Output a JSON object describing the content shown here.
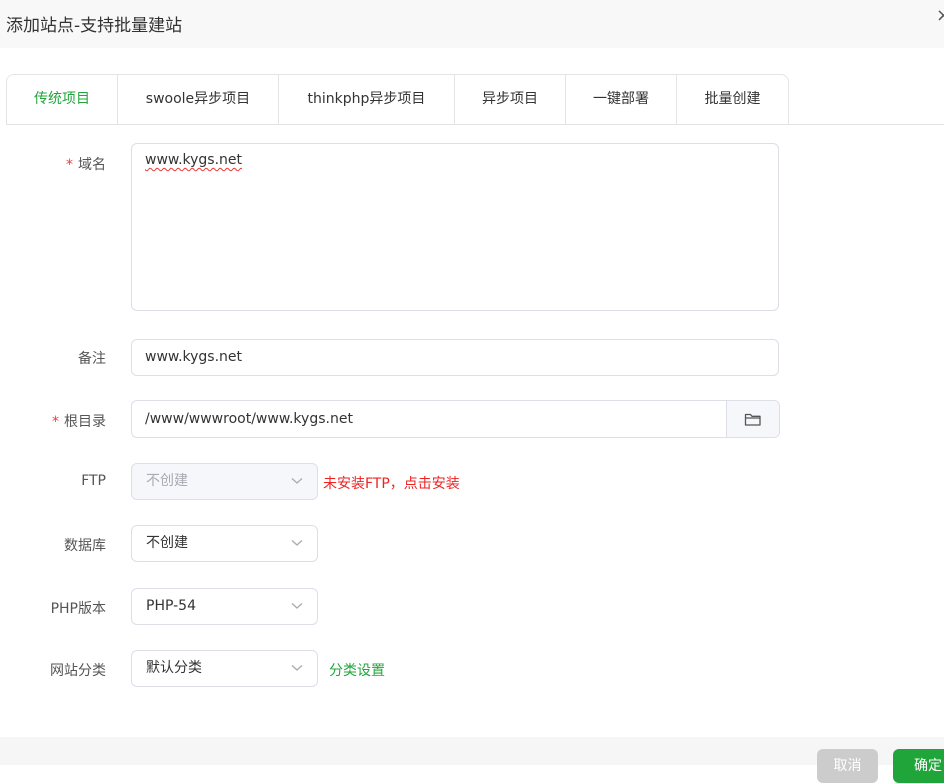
{
  "dialog": {
    "title": "添加站点-支持批量建站",
    "close_label": "×"
  },
  "tabs": [
    {
      "label": "传统项目",
      "active": true
    },
    {
      "label": "swoole异步项目",
      "active": false
    },
    {
      "label": "thinkphp异步项目",
      "active": false
    },
    {
      "label": "异步项目",
      "active": false
    },
    {
      "label": "一键部署",
      "active": false
    },
    {
      "label": "批量创建",
      "active": false
    }
  ],
  "form": {
    "required_mark": "*",
    "domain": {
      "label": "域名",
      "value": "www.kygs.net"
    },
    "remark": {
      "label": "备注",
      "value": "www.kygs.net"
    },
    "root_dir": {
      "label": "根目录",
      "value": "/www/wwwroot/www.kygs.net",
      "icon": "folder-icon"
    },
    "ftp": {
      "label": "FTP",
      "value": "不创建",
      "disabled": true,
      "hint": "未安装FTP，点击安装"
    },
    "database": {
      "label": "数据库",
      "value": "不创建"
    },
    "php_version": {
      "label": "PHP版本",
      "value": "PHP-54"
    },
    "site_category": {
      "label": "网站分类",
      "value": "默认分类",
      "link": "分类设置"
    }
  },
  "footer": {
    "cancel_label": "取消",
    "confirm_label": "确定"
  },
  "colors": {
    "accent": "#20a53a",
    "error": "#ef3a3a",
    "border": "#dcdfe6"
  }
}
